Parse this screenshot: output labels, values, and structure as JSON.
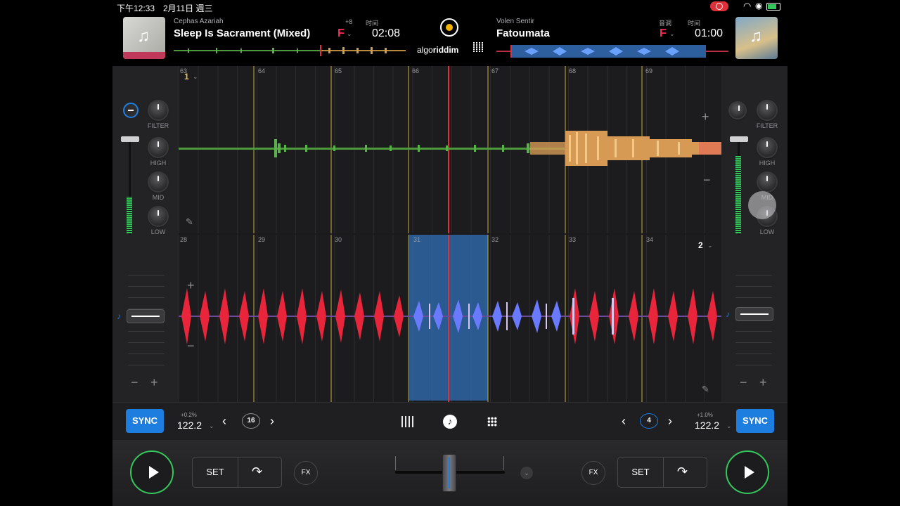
{
  "status": {
    "time": "下午12:33",
    "date": "2月11日 週三"
  },
  "deck_a": {
    "artist": "Cephas Azariah",
    "title": "Sleep Is Sacrament (Mixed)",
    "pitch_shift": "+8",
    "time_label": "时间",
    "key": "F",
    "time": "02:08",
    "deck_number": "1",
    "bpm": "122.2",
    "bpm_delta": "+0.2%",
    "loop_size": "16",
    "sync_label": "SYNC",
    "set_label": "SET",
    "fx_label": "FX"
  },
  "deck_b": {
    "artist": "Volen Sentir",
    "title": "Fatoumata",
    "key_label": "音调",
    "time_label": "时间",
    "key": "F",
    "time": "01:00",
    "deck_number": "2",
    "bpm": "122.2",
    "bpm_delta": "+1.0%",
    "loop_size": "4",
    "sync_label": "SYNC",
    "set_label": "SET",
    "fx_label": "FX"
  },
  "logo": {
    "brand_a": "algo",
    "brand_b": "riddim"
  },
  "eq_labels": {
    "filter": "FILTER",
    "high": "HIGH",
    "mid": "MID",
    "low": "LOW"
  },
  "beats_a": [
    "63",
    "64",
    "65",
    "66",
    "67",
    "68",
    "69"
  ],
  "beats_b": [
    "28",
    "29",
    "30",
    "31",
    "32",
    "33",
    "34"
  ],
  "colors": {
    "accent": "#1e7ee0",
    "play": "#34c759",
    "key": "#ff2d55",
    "loop_region": "#2f6fb5",
    "playhead": "#e0303a"
  },
  "icons": [
    "record-icon",
    "wifi-icon",
    "battery-icon",
    "mixer-icon",
    "music-note-icon",
    "grid-icon",
    "loop-icon",
    "chevron-left-icon",
    "chevron-right-icon",
    "pencil-icon",
    "plus-icon",
    "minus-icon"
  ]
}
